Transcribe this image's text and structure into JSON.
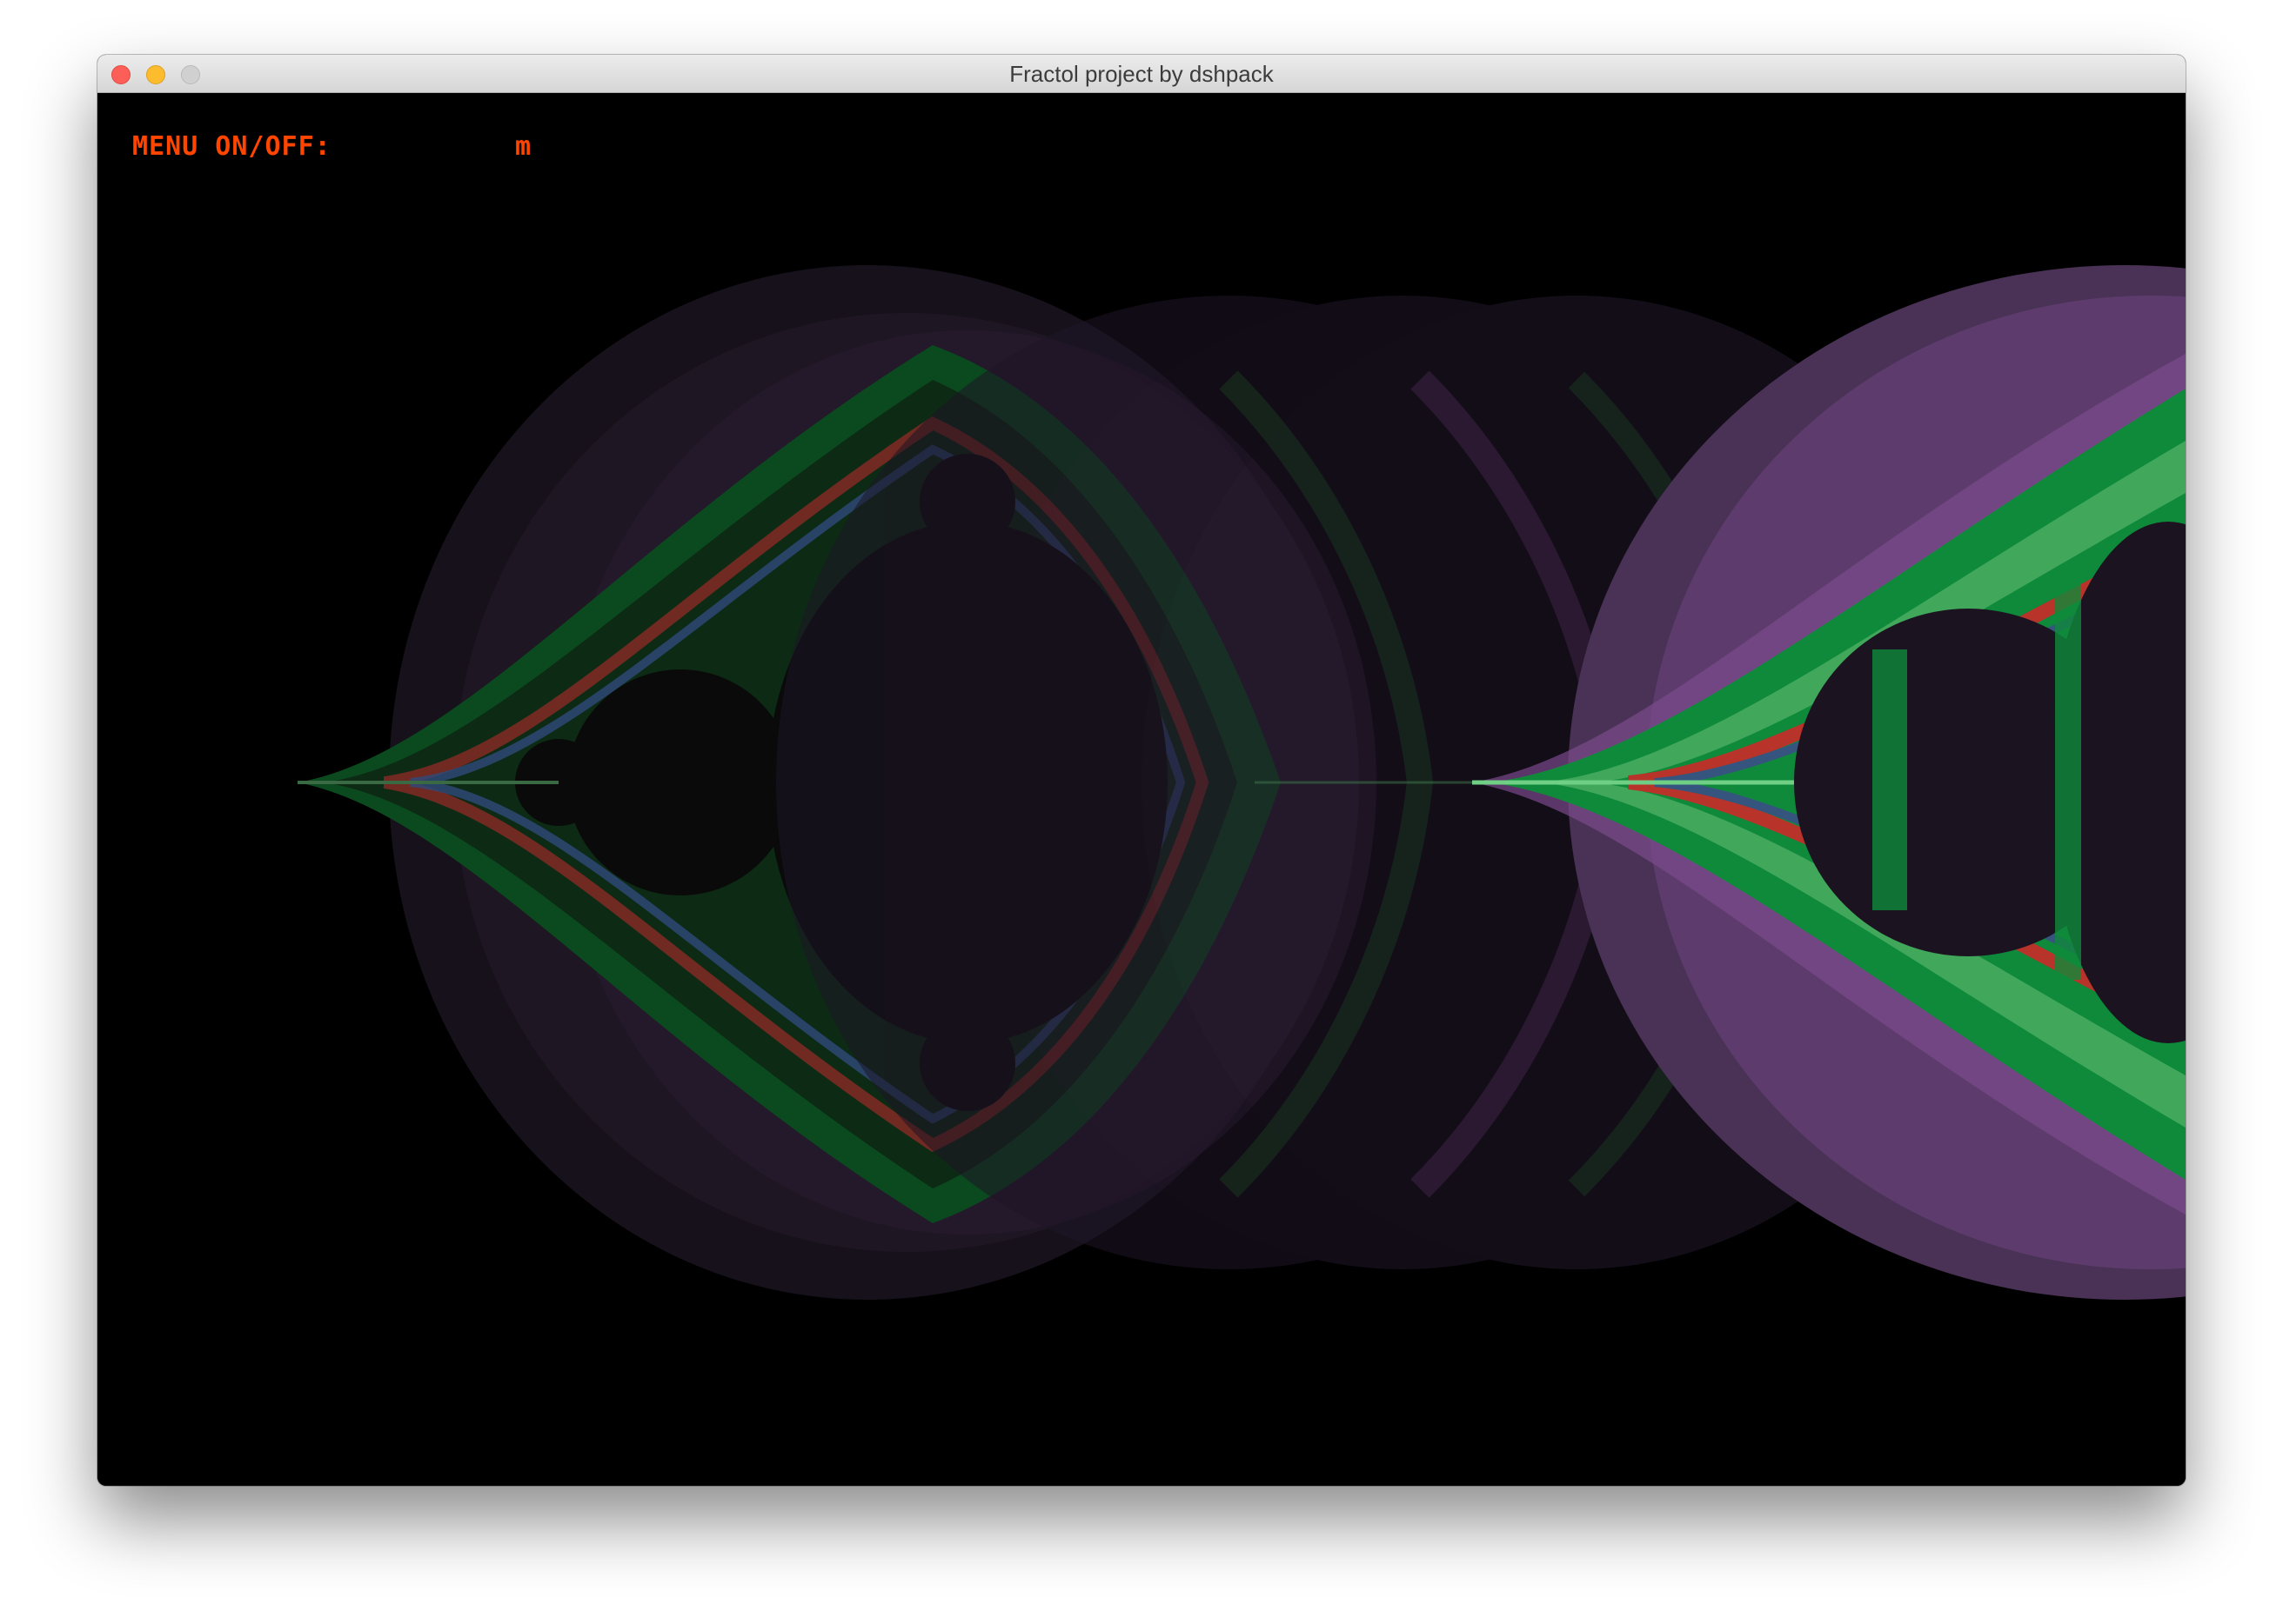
{
  "window": {
    "title": "Fractol project by dshpack"
  },
  "overlay": {
    "menu_label": "MENU ON/OFF:",
    "menu_key": "m",
    "text_color": "#ff4500"
  },
  "fractal": {
    "name": "mandelbrot-style fractal render",
    "colors": {
      "background": "#000000",
      "halo": "#2a1f30",
      "purple": "#7a4a8c",
      "green": "#0e8a3a",
      "red": "#c0392b",
      "interior": "#0a0a0a"
    }
  }
}
